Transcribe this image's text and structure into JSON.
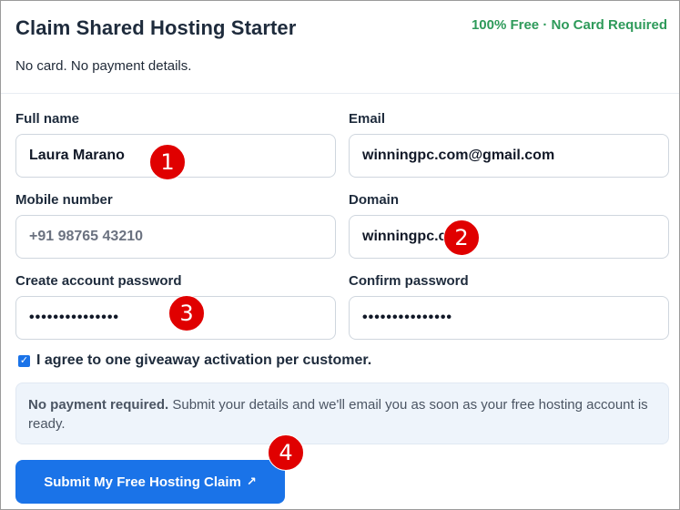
{
  "header": {
    "title": "Claim Shared Hosting Starter",
    "badge": "100% Free · No Card Required",
    "subtitle": "No card. No payment details."
  },
  "form": {
    "full_name": {
      "label": "Full name",
      "value": "Laura Marano"
    },
    "email": {
      "label": "Email",
      "value": "winningpc.com@gmail.com"
    },
    "mobile": {
      "label": "Mobile number",
      "placeholder": "+91 98765 43210",
      "value": ""
    },
    "domain": {
      "label": "Domain",
      "value": "winningpc.com"
    },
    "password": {
      "label": "Create account password",
      "value": "•••••••••••••••"
    },
    "confirm_password": {
      "label": "Confirm password",
      "value": "•••••••••••••••"
    },
    "agree": {
      "label": "I agree to one giveaway activation per customer.",
      "checked": true
    }
  },
  "notice": {
    "strong": "No payment required.",
    "text": " Submit your details and we'll email you as soon as your free hosting account is ready."
  },
  "submit": {
    "label": "Submit My Free Hosting Claim",
    "icon": "external-arrow-icon"
  },
  "markers": [
    "1",
    "2",
    "3",
    "4"
  ],
  "colors": {
    "accent": "#1a73e8",
    "badge": "#2e9a5a",
    "marker": "#e00000"
  }
}
